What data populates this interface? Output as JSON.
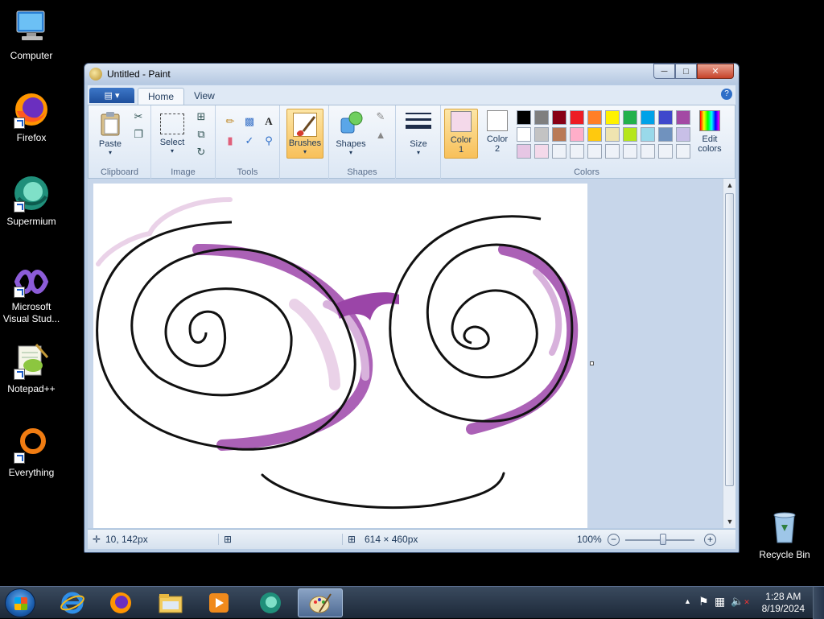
{
  "desktop": {
    "icons": [
      {
        "label": "Computer"
      },
      {
        "label": "Firefox"
      },
      {
        "label": "Supermium"
      },
      {
        "label": "Microsoft Visual Stud..."
      },
      {
        "label": "Notepad++"
      },
      {
        "label": "Everything"
      },
      {
        "label": "Recycle Bin"
      }
    ]
  },
  "window": {
    "title": "Untitled - Paint",
    "tabs": [
      "Home",
      "View"
    ],
    "help": "?"
  },
  "ribbon": {
    "clipboard": {
      "paste": "Paste",
      "group": "Clipboard"
    },
    "image": {
      "select": "Select",
      "group": "Image"
    },
    "tools": {
      "group": "Tools"
    },
    "brushes": "Brushes",
    "shapes": {
      "label": "Shapes",
      "group": "Shapes"
    },
    "size": "Size",
    "color1": {
      "line1": "Color",
      "line2": "1",
      "value": "#f4d9ea"
    },
    "color2": {
      "line1": "Color",
      "line2": "2",
      "value": "#ffffff"
    },
    "edit_colors": {
      "line1": "Edit",
      "line2": "colors"
    },
    "colors_group": "Colors",
    "palette_row1": [
      "#000000",
      "#7f7f7f",
      "#880015",
      "#ed1c24",
      "#ff7f27",
      "#fff200",
      "#22b14c",
      "#00a2e8",
      "#3f48cc",
      "#a349a4"
    ],
    "palette_row2": [
      "#ffffff",
      "#c3c3c3",
      "#b97a57",
      "#ffaec9",
      "#ffc90e",
      "#efe4b0",
      "#b5e61d",
      "#99d9ea",
      "#7092be",
      "#c8bfe7"
    ],
    "palette_row3": [
      "#e6c6e4",
      "#f4d9ea",
      "#eef2f8",
      "#eef2f8",
      "#eef2f8",
      "#eef2f8",
      "#eef2f8",
      "#eef2f8",
      "#eef2f8",
      "#eef2f8"
    ]
  },
  "statusbar": {
    "cursor_pos": "10, 142px",
    "image_size": "614 × 460px",
    "zoom": "100%",
    "zoom_fraction": 0.55
  },
  "taskbar": {
    "time": "1:28 AM",
    "date": "8/19/2024"
  }
}
